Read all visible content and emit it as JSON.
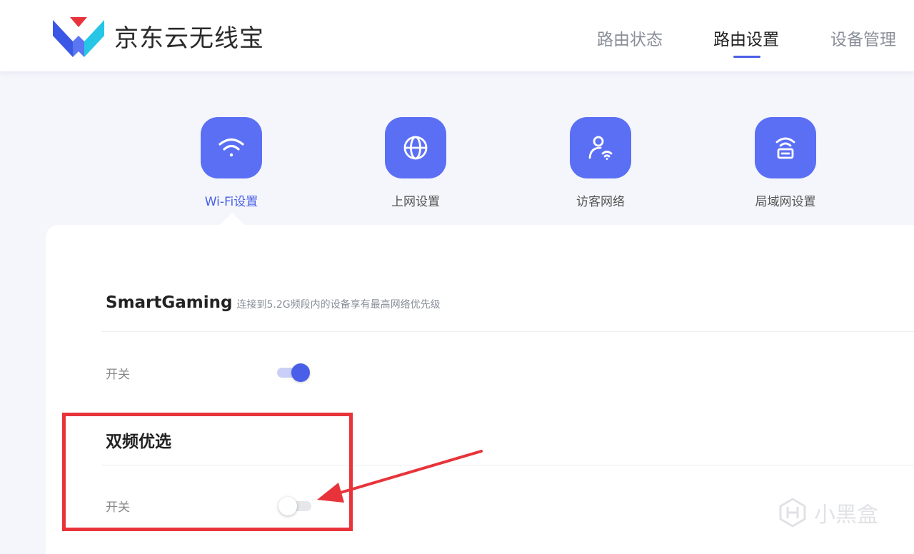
{
  "header": {
    "brand": "京东云无线宝",
    "nav": [
      {
        "label": "路由状态"
      },
      {
        "label": "路由设置"
      },
      {
        "label": "设备管理"
      }
    ]
  },
  "categories": [
    {
      "label": "Wi-Fi设置",
      "icon": "wifi-icon"
    },
    {
      "label": "上网设置",
      "icon": "globe-icon"
    },
    {
      "label": "访客网络",
      "icon": "guest-user-icon"
    },
    {
      "label": "局域网设置",
      "icon": "router-icon"
    }
  ],
  "smartgaming": {
    "title": "SmartGaming",
    "desc": "连接到5.2G频段内的设备享有最高网络优先级",
    "switch_label": "开关",
    "switch_on": true
  },
  "dualband": {
    "title": "双频优选",
    "switch_label": "开关",
    "switch_on": false
  },
  "watermark": {
    "text": "小黑盒"
  },
  "colors": {
    "accent": "#4a5fe8",
    "tile": "#5b6ff5",
    "highlight": "#e8333a"
  }
}
